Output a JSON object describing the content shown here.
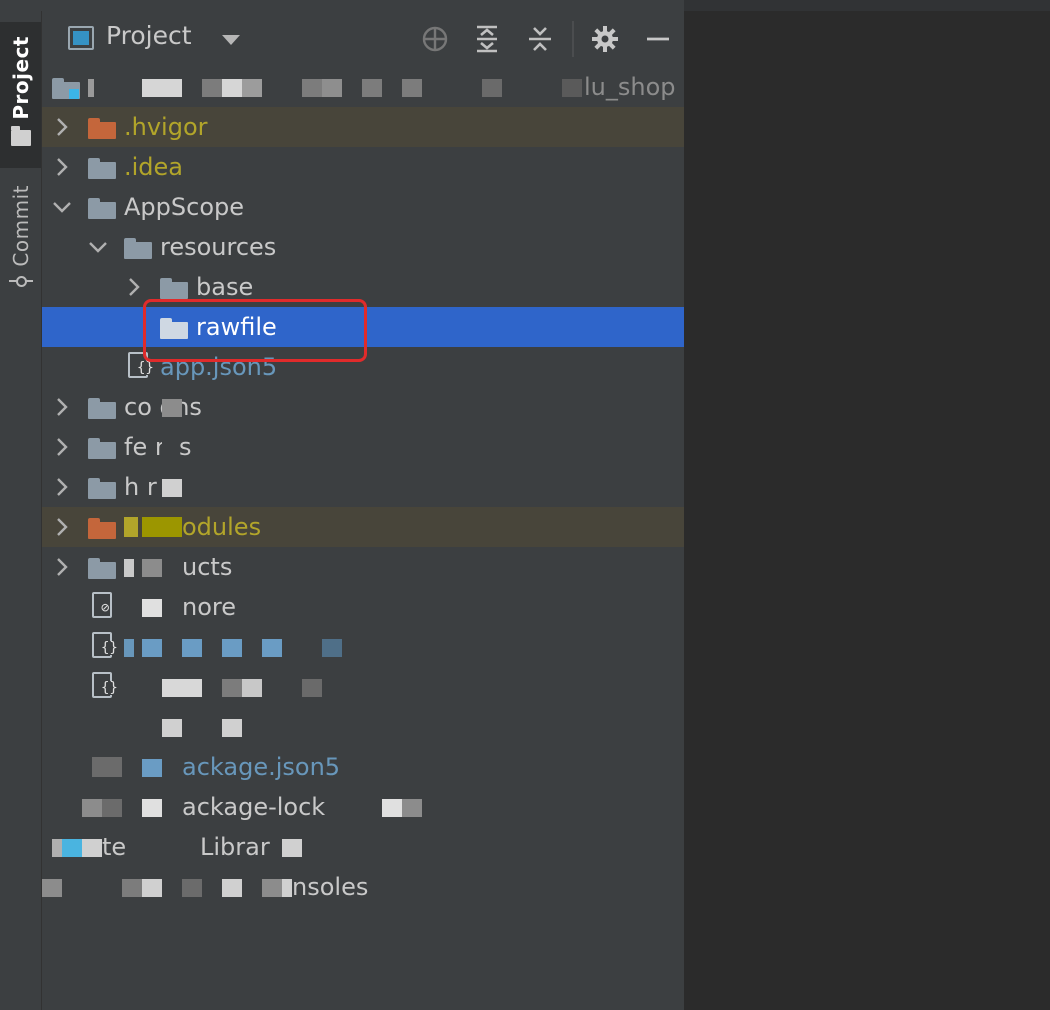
{
  "tool_window_bar": {
    "project_tab_label": "Project",
    "commit_tab_label": "Commit"
  },
  "project_panel": {
    "title": "Project",
    "header_icons": [
      "crosshair-icon",
      "expand-all-icon",
      "collapse-all-icon",
      "gear-icon",
      "minimize-icon"
    ],
    "root_suffix": "lu_shop",
    "tree": {
      "hvigor": ".hvigor",
      "idea": ".idea",
      "appscope": "AppScope",
      "resources": "resources",
      "base": "base",
      "rawfile": "rawfile",
      "app_json5": "app.json5",
      "commons": "co   ons",
      "features": "fe   res",
      "hvigor_dir": "h   r",
      "oh_modules": "odules",
      "products": "ucts",
      "gitignore": "nore",
      "oh_package": "ackage.json5",
      "oh_package_lock": "ackage-lock",
      "external_libraries_a": "te",
      "external_libraries_b": "Librar",
      "scratches": "nsoles"
    }
  },
  "colors": {
    "selection": "#2f65ca",
    "excluded_row": "#48453a",
    "excluded_text": "#b2a52a",
    "json_text": "#6897bb",
    "highlight": "#e02b2b"
  }
}
